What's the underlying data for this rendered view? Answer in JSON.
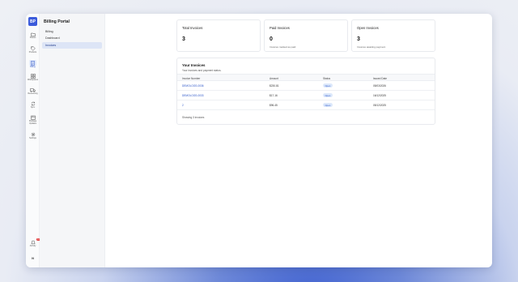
{
  "app": {
    "logo_text": "BP",
    "panel_title": "Billing Portal"
  },
  "rail": [
    {
      "label": "Shares",
      "icon": "folder-icon"
    },
    {
      "label": "Products",
      "icon": "tag-icon"
    },
    {
      "label": "Billing",
      "icon": "invoice-icon"
    },
    {
      "label": "Workspaces",
      "icon": "grid-icon"
    },
    {
      "label": "Resourcing",
      "icon": "truck-icon"
    },
    {
      "label": "Sync",
      "icon": "sync-icon"
    },
    {
      "label": "Package Updates",
      "icon": "package-icon"
    },
    {
      "label": "Settings",
      "icon": "gear-icon"
    }
  ],
  "activity": {
    "label": "Activity",
    "badge": "10"
  },
  "user": {
    "initials": "N"
  },
  "nav": [
    {
      "label": "Billing"
    },
    {
      "label": "Dashboard"
    },
    {
      "label": "Invoices"
    }
  ],
  "stats": [
    {
      "title": "Total Invoices",
      "value": "3",
      "sub": ""
    },
    {
      "title": "Paid Invoices",
      "value": "0",
      "sub": "Invoices marked as paid"
    },
    {
      "title": "Open Invoices",
      "value": "3",
      "sub": "Invoices awaiting payment"
    }
  ],
  "invoices": {
    "title": "Your Invoices",
    "subtitle": "Your invoices and payment status.",
    "columns": [
      "Invoice Number",
      "Amount",
      "Status",
      "Issued Date"
    ],
    "rows": [
      {
        "number": "DEMOLOGS-0036",
        "amount": "$230.81",
        "status": "Open",
        "date": "05/03/2026"
      },
      {
        "number": "DEMOLOGS-0033",
        "amount": "$17.16",
        "status": "Open",
        "date": "16/12/2025"
      },
      {
        "number": "2",
        "amount": "$96.45",
        "status": "Open",
        "date": "05/12/2025"
      }
    ],
    "footer": "Showing 3 invoices"
  },
  "colors": {
    "accent": "#2b55c8",
    "logo": "#3b5bdb",
    "badge": "#e03131"
  }
}
